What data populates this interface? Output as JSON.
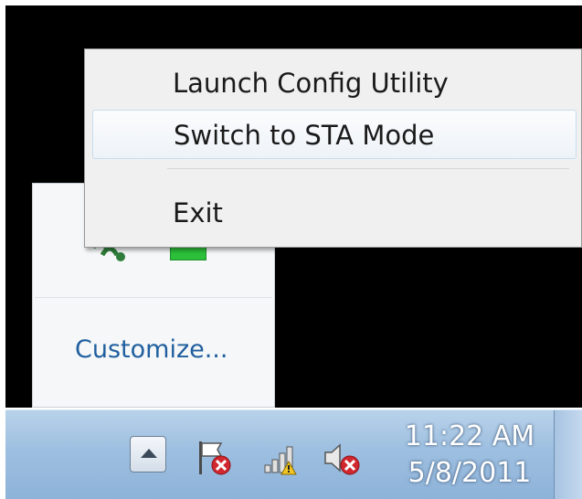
{
  "context_menu": {
    "items": [
      {
        "label": "Launch Config Utility"
      },
      {
        "label": "Switch to STA Mode"
      },
      {
        "label": "Exit"
      }
    ]
  },
  "tray_overflow": {
    "customize_label": "Customize...",
    "icons": [
      "wifi-utility-icon",
      "green-status-icon"
    ]
  },
  "taskbar": {
    "clock": {
      "time": "11:22 AM",
      "date": "5/8/2011"
    },
    "icons": [
      "show-hidden-icons-arrow",
      "action-center-flag-icon",
      "network-signal-icon",
      "volume-muted-icon"
    ]
  },
  "colors": {
    "link": "#1f5f9f",
    "menu_background": "#f0f0f0",
    "highlight_border": "#c8dcef",
    "taskbar": "#9dbfe0",
    "tray_green": "#2bbf3a",
    "error_red": "#d0282e"
  }
}
